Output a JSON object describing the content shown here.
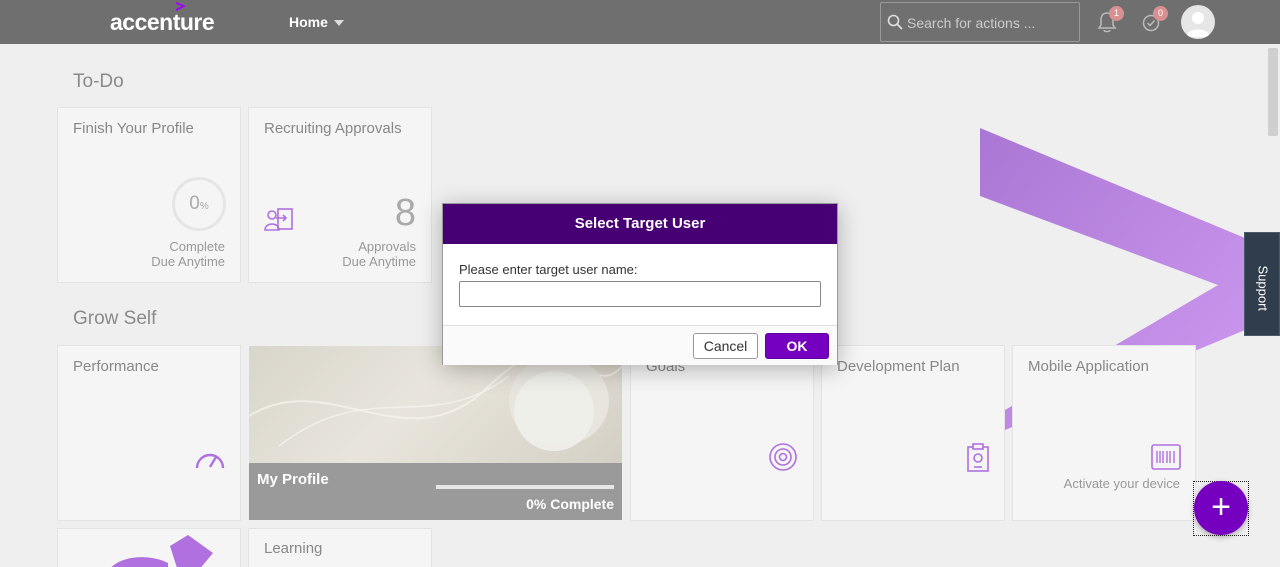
{
  "header": {
    "logo": "accenture",
    "home_label": "Home",
    "search_placeholder": "Search for actions ...",
    "notifications_count": "1",
    "approvals_count": "0"
  },
  "todo": {
    "title": "To-Do",
    "finish_profile": {
      "title": "Finish Your Profile",
      "percent": "0",
      "percent_sign": "%",
      "line1": "Complete",
      "line2": "Due Anytime"
    },
    "recruiting": {
      "title": "Recruiting Approvals",
      "count": "8",
      "line1": "Approvals",
      "line2": "Due Anytime"
    }
  },
  "grow_self": {
    "title": "Grow Self",
    "performance": "Performance",
    "my_profile": {
      "name": "My Profile",
      "progress": 0,
      "complete_text": "0% Complete"
    },
    "goals": "Goals",
    "development_plan": "Development Plan",
    "mobile": {
      "title": "Mobile Application",
      "sub": "Activate your device"
    },
    "learning": "Learning"
  },
  "support": "Support",
  "dialog": {
    "title": "Select Target User",
    "label": "Please enter target user name:",
    "input_value": "",
    "cancel": "Cancel",
    "ok": "OK"
  },
  "fab": "+",
  "colors": {
    "brand": "#7500c0",
    "dialog_header": "#460073",
    "header_bg": "#6f6f6f",
    "decor": "#a060d8"
  },
  "icons": [
    "search-icon",
    "bell-icon",
    "approval-check-icon",
    "avatar",
    "recruiting-icon",
    "gauge-icon",
    "target-icon",
    "clipboard-icon",
    "mobile-barcode-icon",
    "plus-icon"
  ]
}
